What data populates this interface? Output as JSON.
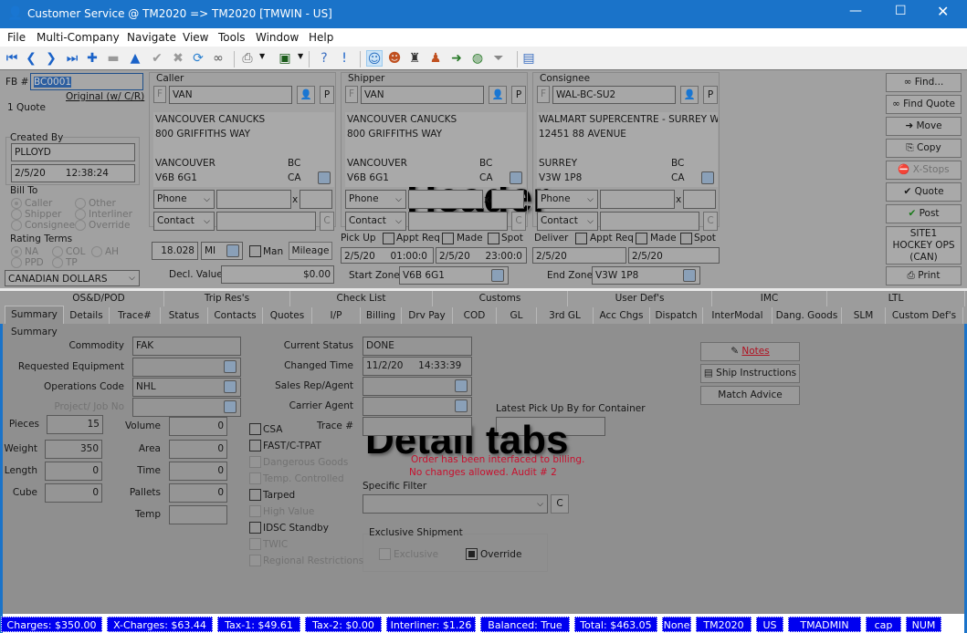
{
  "window": {
    "title": "Customer Service @ TM2020 => TM2020 [TMWIN - US]",
    "controls": [
      "minimize",
      "maximize",
      "close"
    ]
  },
  "menu": [
    "File",
    "Multi-Company",
    "Navigate",
    "View",
    "Tools",
    "Window",
    "Help"
  ],
  "toolbar": [
    "first-record-icon",
    "previous-record-icon",
    "next-record-icon",
    "last-record-icon",
    "add-icon",
    "remove-icon",
    "up-icon",
    "accept-icon",
    "cancel-icon",
    "refresh-icon",
    "binoculars-icon",
    "print-icon",
    "monitor-icon",
    "help-icon",
    "info-icon",
    "customer-service-icon",
    "dispatch-icon",
    "driver-icon",
    "agent-icon",
    "route-icon",
    "globe-icon",
    "filter-icon",
    "document-icon"
  ],
  "overlay_labels": {
    "header": "Header",
    "detail": "Detail tabs"
  },
  "header": {
    "fb_label": "FB #",
    "fb_value": "BC0001",
    "original_link": "Original (w/ C/R)",
    "quote_count": "1 Quote",
    "created_by_label": "Created By",
    "created_by": "PLLOYD",
    "created_date": "2/5/20",
    "created_time": "12:38:24",
    "bill_to_label": "Bill To",
    "bill_to_options": [
      "Caller",
      "Other",
      "Shipper",
      "Interliner",
      "Consignee",
      "Override"
    ],
    "bill_to_selected": "Caller",
    "rating_terms_label": "Rating Terms",
    "rating_terms_options": [
      "NA",
      "COL",
      "AH",
      "PPD",
      "TP"
    ],
    "rating_terms_selected": "NA",
    "currency": "CANADIAN DOLLARS",
    "caller": {
      "label": "Caller",
      "f": "F",
      "code": "VAN",
      "p": "P",
      "name": "VANCOUVER CANUCKS",
      "address": "800 GRIFFITHS WAY",
      "city": "VANCOUVER",
      "state": "BC",
      "postal": "V6B 6G1",
      "country": "CA",
      "phone_select": "Phone",
      "x": "x",
      "contact_select": "Contact",
      "c": "C"
    },
    "shipper": {
      "label": "Shipper",
      "f": "F",
      "code": "VAN",
      "p": "P",
      "name": "VANCOUVER CANUCKS",
      "address": "800 GRIFFITHS WAY",
      "city": "VANCOUVER",
      "state": "BC",
      "postal": "V6B 6G1",
      "country": "CA",
      "phone_select": "Phone",
      "x": "x",
      "contact_select": "Contact",
      "c": "C"
    },
    "consignee": {
      "label": "Consignee",
      "f": "F",
      "code": "WAL-BC-SU2",
      "p": "P",
      "name": "WALMART SUPERCENTRE - SURREY WES",
      "address": "12451 88 AVENUE",
      "city": "SURREY",
      "state": "BC",
      "postal": "V3W 1P8",
      "country": "CA",
      "phone_select": "Phone",
      "x": "x",
      "contact_select": "Contact",
      "c": "C"
    },
    "mileage": {
      "value": "18.028",
      "unit": "MI",
      "man_label": "Man",
      "button": "Mileage"
    },
    "decl_value_label": "Decl. Value",
    "decl_value": "$0.00",
    "pickup": {
      "label": "Pick Up",
      "appt_req": "Appt Req",
      "made": "Made",
      "spot": "Spot",
      "from": "2/5/20     01:00:0",
      "to": "2/5/20     23:00:0",
      "zone_label": "Start Zone",
      "zone": "V6B 6G1"
    },
    "deliver": {
      "label": "Deliver",
      "appt_req": "Appt Req",
      "made": "Made",
      "spot": "Spot",
      "from": "2/5/20",
      "to": "2/5/20",
      "zone_label": "End Zone",
      "zone": "V3W 1P8"
    },
    "side_buttons": [
      "Find...",
      "Find Quote",
      "Move",
      "Copy",
      "X-Stops",
      "Quote",
      "Post",
      "SITE1\nHOCKEY OPS\n(CAN)",
      "Print"
    ]
  },
  "tabs": {
    "row1": [
      "OS&D/POD",
      "Trip Res's",
      "Check List",
      "Customs",
      "User Def's",
      "IMC",
      "LTL"
    ],
    "row2": [
      "Summary",
      "Details",
      "Trace#",
      "Status",
      "Contacts",
      "Quotes",
      "I/P",
      "Billing",
      "Drv Pay",
      "COD",
      "GL",
      "3rd GL",
      "Acc Chgs",
      "Dispatch",
      "InterModal",
      "Dang. Goods",
      "SLM",
      "Custom Def's"
    ],
    "active": "Summary"
  },
  "summary": {
    "group_label": "Summary",
    "commodity_label": "Commodity",
    "commodity": "FAK",
    "req_equipment_label": "Requested Equipment",
    "req_equipment": "",
    "ops_code_label": "Operations Code",
    "ops_code": "NHL",
    "project_label": "Project/ Job No",
    "project": "",
    "pieces_label": "Pieces",
    "pieces": "15",
    "weight_label": "Weight",
    "weight": "350",
    "length_label": "Length",
    "length": "0",
    "cube_label": "Cube",
    "cube": "0",
    "volume_label": "Volume",
    "volume": "0",
    "area_label": "Area",
    "area": "0",
    "time_label": "Time",
    "time": "0",
    "pallets_label": "Pallets",
    "pallets": "0",
    "temp_label": "Temp",
    "temp": "",
    "checkboxes": [
      {
        "label": "CSA",
        "enabled": true,
        "checked": false
      },
      {
        "label": "FAST/C-TPAT",
        "enabled": true,
        "checked": false
      },
      {
        "label": "Dangerous Goods",
        "enabled": false,
        "checked": false
      },
      {
        "label": "Temp. Controlled",
        "enabled": false,
        "checked": false
      },
      {
        "label": "Tarped",
        "enabled": true,
        "checked": false
      },
      {
        "label": "High Value",
        "enabled": false,
        "checked": false
      },
      {
        "label": "IDSC Standby",
        "enabled": true,
        "checked": false
      },
      {
        "label": "TWIC",
        "enabled": false,
        "checked": false
      },
      {
        "label": "Regional Restrictions",
        "enabled": false,
        "checked": false
      }
    ],
    "current_status_label": "Current Status",
    "current_status": "DONE",
    "changed_time_label": "Changed Time",
    "changed_time": "11/2/20     14:33:39",
    "sales_rep_label": "Sales Rep/Agent",
    "sales_rep": "",
    "carrier_agent_label": "Carrier Agent",
    "carrier_agent": "",
    "trace_label": "Trace #",
    "trace": "",
    "latest_pickup_label": "Latest Pick Up By for Container",
    "latest_pickup": "",
    "message_line1": "Order has been interfaced to billing.",
    "message_line2": "No changes allowed. Audit # 2",
    "message_color": "#c8102e",
    "specific_filter_label": "Specific Filter",
    "specific_filter": "",
    "c": "C",
    "exclusive_group_label": "Exclusive Shipment",
    "exclusive_label": "Exclusive",
    "override_label": "Override",
    "notes_button": "Notes",
    "ship_instructions_button": "Ship Instructions",
    "match_advice_button": "Match Advice"
  },
  "statusbar": [
    "Charges: $350.00",
    "X-Charges: $63.44",
    "Tax-1: $49.61",
    "Tax-2: $0.00",
    "Interliner: $1.26",
    "Balanced: True",
    "Total: $463.05",
    "None",
    "TM2020",
    "US",
    "TMADMIN",
    "cap",
    "NUM"
  ],
  "colors": {
    "titlebar": "#1a73c9",
    "statusbar_item": "#0000f0"
  }
}
